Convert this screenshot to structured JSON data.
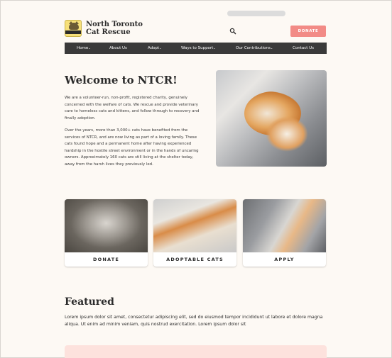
{
  "header": {
    "org_name_line1": "North Toronto",
    "org_name_line2": "Cat Rescue",
    "logo_icon": "cat-logo-icon",
    "search_icon": "search-icon",
    "donate_label": "DONATE"
  },
  "nav": {
    "items": [
      {
        "label": "Home",
        "has_caret": true
      },
      {
        "label": "About Us",
        "has_caret": false
      },
      {
        "label": "Adopt",
        "has_caret": true
      },
      {
        "label": "Ways to Support",
        "has_caret": true
      },
      {
        "label": "Our Contributions",
        "has_caret": true
      },
      {
        "label": "Contact Us",
        "has_caret": false
      }
    ],
    "caret": "⌄"
  },
  "welcome": {
    "title": "Welcome to NTCR!",
    "para1": "We are a volunteer-run, non-profit, registered charity, genuinely concerned with the welfare of cats. We rescue and provide veterinary care to homeless cats and kittens, and follow through to recovery and finally adoption.",
    "para2": "Over the years, more than 3,000+ cats have benefited from the services of NTCR, and are now living as part of a loving family. These cats found hope and a permanent home after having experienced hardship in the hostile street environment or in the hands of uncaring owners. Approximately 160 cats are still living at the shelter today, away from the harsh lives they previously led."
  },
  "cards": [
    {
      "label": "DONATE"
    },
    {
      "label": "ADOPTABLE CATS"
    },
    {
      "label": "APPLY"
    }
  ],
  "featured": {
    "title": "Featured",
    "text": "Lorem ipsum dolor sit amet, consectetur adipiscing elit, sed do eiusmod tempor incididunt ut labore et dolore magna aliqua. Ut enim ad minim veniam, quis nostrud exercitation. Lorem ipsum dolor sit"
  },
  "colors": {
    "accent": "#f28b86",
    "nav_bg": "#3a3a3a",
    "page_bg": "#fdf9f4",
    "panel_pink": "#fde2dd"
  }
}
